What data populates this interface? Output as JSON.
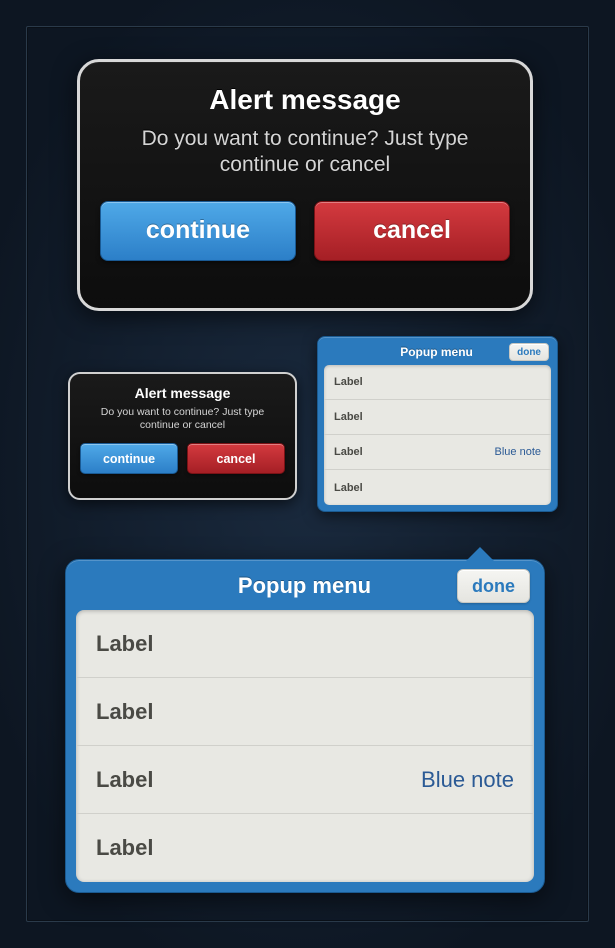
{
  "alert_large": {
    "title": "Alert message",
    "message": "Do you want to continue? Just type continue or cancel",
    "continue_label": "continue",
    "cancel_label": "cancel"
  },
  "alert_small": {
    "title": "Alert message",
    "message": "Do you want to continue? Just type continue or cancel",
    "continue_label": "continue",
    "cancel_label": "cancel"
  },
  "popup_small": {
    "title": "Popup menu",
    "done_label": "done",
    "items": [
      {
        "label": "Label",
        "note": ""
      },
      {
        "label": "Label",
        "note": ""
      },
      {
        "label": "Label",
        "note": "Blue note"
      },
      {
        "label": "Label",
        "note": ""
      }
    ]
  },
  "popup_large": {
    "title": "Popup menu",
    "done_label": "done",
    "items": [
      {
        "label": "Label",
        "note": ""
      },
      {
        "label": "Label",
        "note": ""
      },
      {
        "label": "Label",
        "note": "Blue note"
      },
      {
        "label": "Label",
        "note": ""
      }
    ]
  },
  "colors": {
    "accent_blue": "#2b7abd",
    "button_blue": "#3a94d8",
    "button_red": "#c02e33",
    "note_blue": "#2b5a95"
  }
}
